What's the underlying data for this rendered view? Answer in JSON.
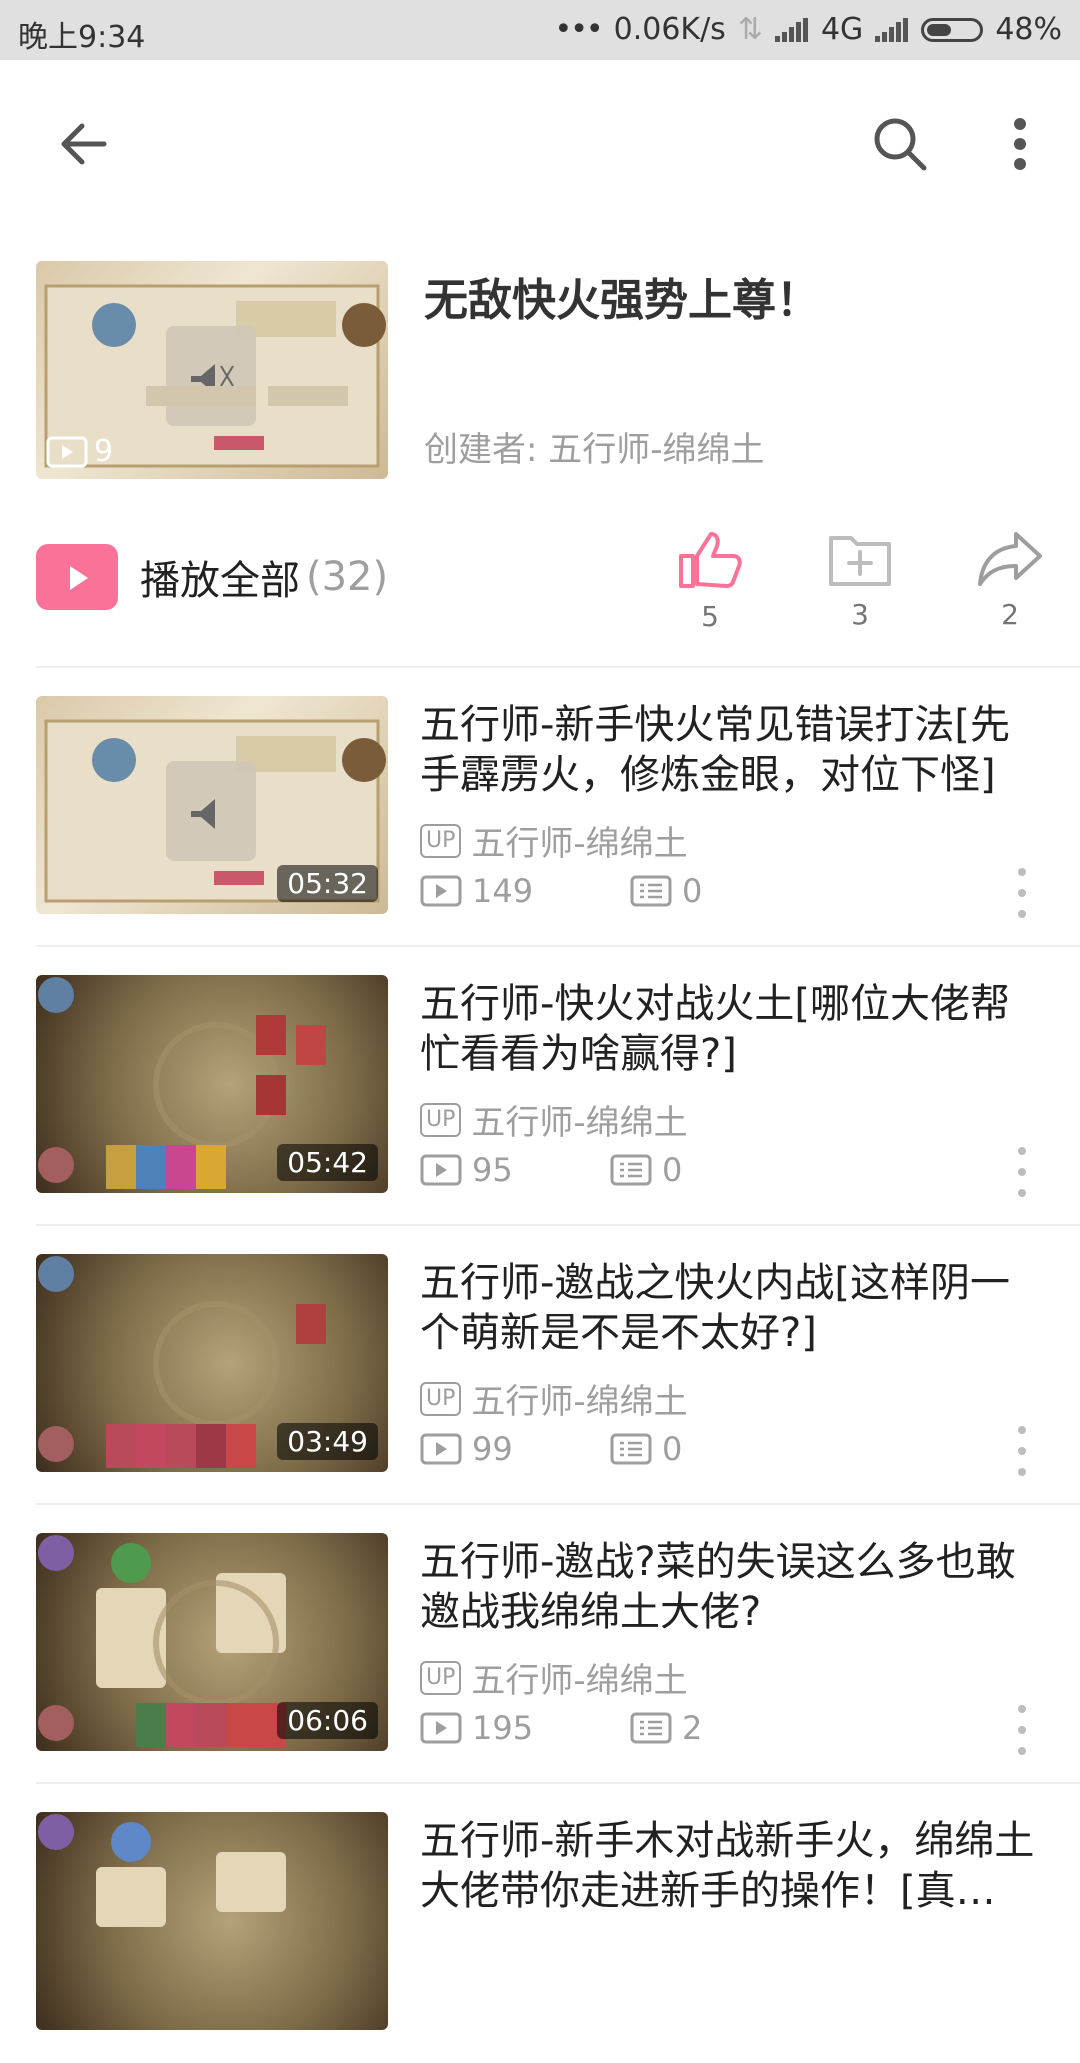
{
  "status_bar": {
    "time": "晚上9:34",
    "network_speed": "0.06K/s",
    "network_type": "4G",
    "battery": "48%",
    "battery_level": 0.48
  },
  "toolbar": {
    "back_icon": "arrow-left-icon",
    "search_icon": "search-icon",
    "more_icon": "more-vertical-icon"
  },
  "playlist": {
    "title": "无敌快火强势上尊！",
    "creator": "创建者: 五行师-绵绵土",
    "video_count": "9"
  },
  "actions": {
    "play_all_label": "播放全部",
    "play_all_count": "(32)",
    "like_count": "5",
    "favorite_count": "3",
    "share_count": "2",
    "accent_color": "#fb7299"
  },
  "videos": [
    {
      "title": "五行师-新手快火常见错误打法[先手霹雳火，修炼金眼，对位下怪]",
      "uploader": "五行师-绵绵土",
      "plays": "149",
      "comments": "0",
      "duration": "05:32"
    },
    {
      "title": "五行师-快火对战火土[哪位大佬帮忙看看为啥赢得?]",
      "uploader": "五行师-绵绵土",
      "plays": "95",
      "comments": "0",
      "duration": "05:42"
    },
    {
      "title": "五行师-邀战之快火内战[这样阴一个萌新是不是不太好?]",
      "uploader": "五行师-绵绵土",
      "plays": "99",
      "comments": "0",
      "duration": "03:49"
    },
    {
      "title": "五行师-邀战?菜的失误这么多也敢邀战我绵绵土大佬?",
      "uploader": "五行师-绵绵土",
      "plays": "195",
      "comments": "2",
      "duration": "06:06"
    },
    {
      "title": "五行师-新手木对战新手火，绵绵土大佬带你走进新手的操作！[真…",
      "uploader": "",
      "plays": "",
      "comments": "",
      "duration": ""
    }
  ],
  "up_badge": "UP"
}
